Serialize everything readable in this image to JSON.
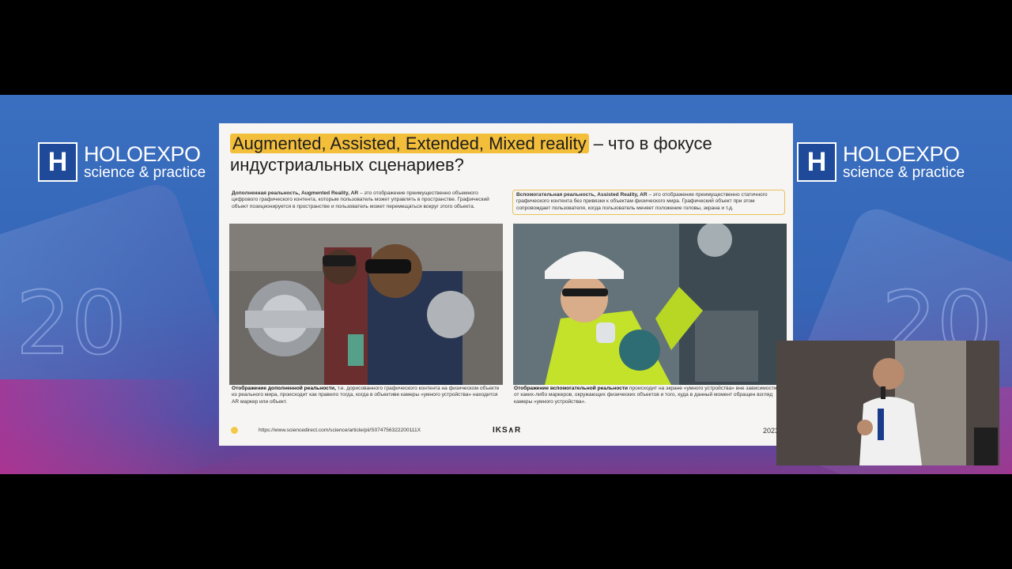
{
  "brand": {
    "logo_letter": "H",
    "name": "HOLOEXPO",
    "tagline": "science & practice",
    "year_bg": "20"
  },
  "slide": {
    "title_highlight": "Augmented, Assisted, Extended, Mixed reality",
    "title_rest": " – что в фокусе индустриальных сценариев?",
    "left": {
      "desc_bold": "Дополненная реальность, Augmented Reality, AR",
      "desc_text": " – это отображение преимущественно объемного цифрового графического контента, которым пользователь может управлять в пространстве. Графический объект позиционируется в пространстве и пользователь может перемещаться вокруг этого объекта.",
      "caption_bold": "Отображение дополненной реальности,",
      "caption_text": " т.е. дорисованного графического контента на физическом объекте из реального мира, происходит как правило тогда, когда в объективе камеры «умного устройства» находится AR маркер или объект."
    },
    "right": {
      "desc_bold": "Вспомогательная реальность, Assisted Reality, AR",
      "desc_text": " – это отображение преимущественно статичного графического контента без привязки к объектам физического мира. Графический объект при этом сопровождает пользователя, когда пользователь меняет положение головы, экрана и т.д.",
      "caption_bold": "Отображение вспомогательной реальности",
      "caption_text": " происходит на экране «умного устройства» вне зависимости от каких-либо маркеров, окружающих физических объектов и того, куда в данный момент обращен взгляд камеры «умного устройства»."
    },
    "footer": {
      "url": "https://www.sciencedirect.com/science/article/pii/S074756322200111X",
      "brand": "IKS∧R",
      "year": "2023"
    }
  },
  "colors": {
    "background_blue": "#3565b6",
    "highlight": "#f3be3a"
  }
}
